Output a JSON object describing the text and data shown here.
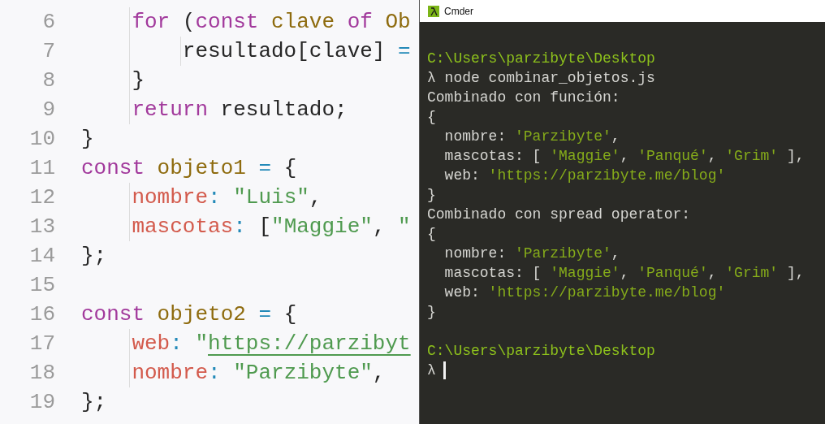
{
  "editor": {
    "lines": [
      {
        "children": [
          {
            "number": "6",
            "tokens": [
              {
                "kind": "keyword",
                "text": "for"
              },
              {
                "kind": "plain",
                "text": " ("
              },
              {
                "kind": "keyword",
                "text": "const"
              },
              {
                "kind": "ident",
                "text": " clave"
              },
              {
                "kind": "keyword",
                "text": " of"
              },
              {
                "kind": "ident",
                "text": " Ob"
              }
            ],
            "children": [
              {
                "number": "7",
                "tokens": [
                  {
                    "kind": "plain",
                    "text": "resultado[clave]"
                  },
                  {
                    "kind": "op",
                    "text": " ="
                  }
                ]
              }
            ]
          },
          {
            "number": "8",
            "tokens": [
              {
                "kind": "plain",
                "text": "}"
              }
            ]
          },
          {
            "number": "9",
            "tokens": [
              {
                "kind": "keyword",
                "text": "return"
              },
              {
                "kind": "plain",
                "text": " resultado;"
              }
            ]
          }
        ]
      },
      {
        "number": "10",
        "tokens": [
          {
            "kind": "plain",
            "text": "}"
          }
        ]
      },
      {
        "number": "11",
        "tokens": [
          {
            "kind": "keyword",
            "text": "const"
          },
          {
            "kind": "ident",
            "text": " objeto1"
          },
          {
            "kind": "op",
            "text": " ="
          },
          {
            "kind": "plain",
            "text": " {"
          }
        ],
        "children": [
          {
            "number": "12",
            "tokens": [
              {
                "kind": "prop",
                "text": "nombre"
              },
              {
                "kind": "op",
                "text": ":"
              },
              {
                "kind": "string",
                "text": " \"Luis\""
              },
              {
                "kind": "plain",
                "text": ","
              }
            ]
          },
          {
            "number": "13",
            "tokens": [
              {
                "kind": "prop",
                "text": "mascotas"
              },
              {
                "kind": "op",
                "text": ":"
              },
              {
                "kind": "plain",
                "text": " ["
              },
              {
                "kind": "string",
                "text": "\"Maggie\""
              },
              {
                "kind": "plain",
                "text": ","
              },
              {
                "kind": "string",
                "text": " \""
              }
            ]
          }
        ]
      },
      {
        "number": "14",
        "tokens": [
          {
            "kind": "plain",
            "text": "};"
          }
        ]
      },
      {
        "number": "15"
      },
      {
        "number": "16",
        "tokens": [
          {
            "kind": "keyword",
            "text": "const"
          },
          {
            "kind": "ident",
            "text": " objeto2"
          },
          {
            "kind": "op",
            "text": " ="
          },
          {
            "kind": "plain",
            "text": " {"
          }
        ],
        "children": [
          {
            "number": "17",
            "tokens": [
              {
                "kind": "prop",
                "text": "web"
              },
              {
                "kind": "op",
                "text": ":"
              },
              {
                "kind": "string",
                "text": " \""
              },
              {
                "kind": "link",
                "text": "https://parzibyt"
              }
            ]
          },
          {
            "number": "18",
            "tokens": [
              {
                "kind": "prop",
                "text": "nombre"
              },
              {
                "kind": "op",
                "text": ":"
              },
              {
                "kind": "string",
                "text": " \"Parzibyte\""
              },
              {
                "kind": "plain",
                "text": ","
              }
            ]
          }
        ]
      },
      {
        "number": "19",
        "tokens": [
          {
            "kind": "plain",
            "text": "};"
          }
        ]
      }
    ]
  },
  "terminal": {
    "title": "Cmder",
    "lines": [
      {
        "tokens": [
          {
            "kind": "path",
            "text": "C:\\Users\\parzibyte\\Desktop"
          }
        ]
      },
      {
        "tokens": [
          {
            "kind": "text",
            "text": "λ node combinar_objetos.js"
          }
        ]
      },
      {
        "tokens": [
          {
            "kind": "text",
            "text": "Combinado con función:"
          }
        ]
      },
      {
        "tokens": [
          {
            "kind": "text",
            "text": "{"
          }
        ]
      },
      {
        "tokens": [
          {
            "kind": "text",
            "text": "  nombre:"
          },
          {
            "kind": "string",
            "text": " 'Parzibyte'"
          },
          {
            "kind": "text",
            "text": ","
          }
        ]
      },
      {
        "tokens": [
          {
            "kind": "text",
            "text": "  mascotas: ["
          },
          {
            "kind": "string",
            "text": " 'Maggie'"
          },
          {
            "kind": "text",
            "text": ","
          },
          {
            "kind": "string",
            "text": " 'Panqué'"
          },
          {
            "kind": "text",
            "text": ","
          },
          {
            "kind": "string",
            "text": " 'Grim'"
          },
          {
            "kind": "text",
            "text": " ],"
          }
        ]
      },
      {
        "tokens": [
          {
            "kind": "text",
            "text": "  web:"
          },
          {
            "kind": "string",
            "text": " 'https://parzibyte.me/blog'"
          }
        ]
      },
      {
        "tokens": [
          {
            "kind": "text",
            "text": "}"
          }
        ]
      },
      {
        "tokens": [
          {
            "kind": "text",
            "text": "Combinado con spread operator:"
          }
        ]
      },
      {
        "tokens": [
          {
            "kind": "text",
            "text": "{"
          }
        ]
      },
      {
        "tokens": [
          {
            "kind": "text",
            "text": "  nombre:"
          },
          {
            "kind": "string",
            "text": " 'Parzibyte'"
          },
          {
            "kind": "text",
            "text": ","
          }
        ]
      },
      {
        "tokens": [
          {
            "kind": "text",
            "text": "  mascotas: ["
          },
          {
            "kind": "string",
            "text": " 'Maggie'"
          },
          {
            "kind": "text",
            "text": ","
          },
          {
            "kind": "string",
            "text": " 'Panqué'"
          },
          {
            "kind": "text",
            "text": ","
          },
          {
            "kind": "string",
            "text": " 'Grim'"
          },
          {
            "kind": "text",
            "text": " ],"
          }
        ]
      },
      {
        "tokens": [
          {
            "kind": "text",
            "text": "  web:"
          },
          {
            "kind": "string",
            "text": " 'https://parzibyte.me/blog'"
          }
        ]
      },
      {
        "tokens": [
          {
            "kind": "text",
            "text": "}"
          }
        ]
      },
      {
        "gap_before": true,
        "tokens": [
          {
            "kind": "path",
            "text": "C:\\Users\\parzibyte\\Desktop"
          }
        ]
      },
      {
        "tokens": [
          {
            "kind": "text",
            "text": "λ"
          }
        ],
        "cursor": true
      }
    ]
  }
}
